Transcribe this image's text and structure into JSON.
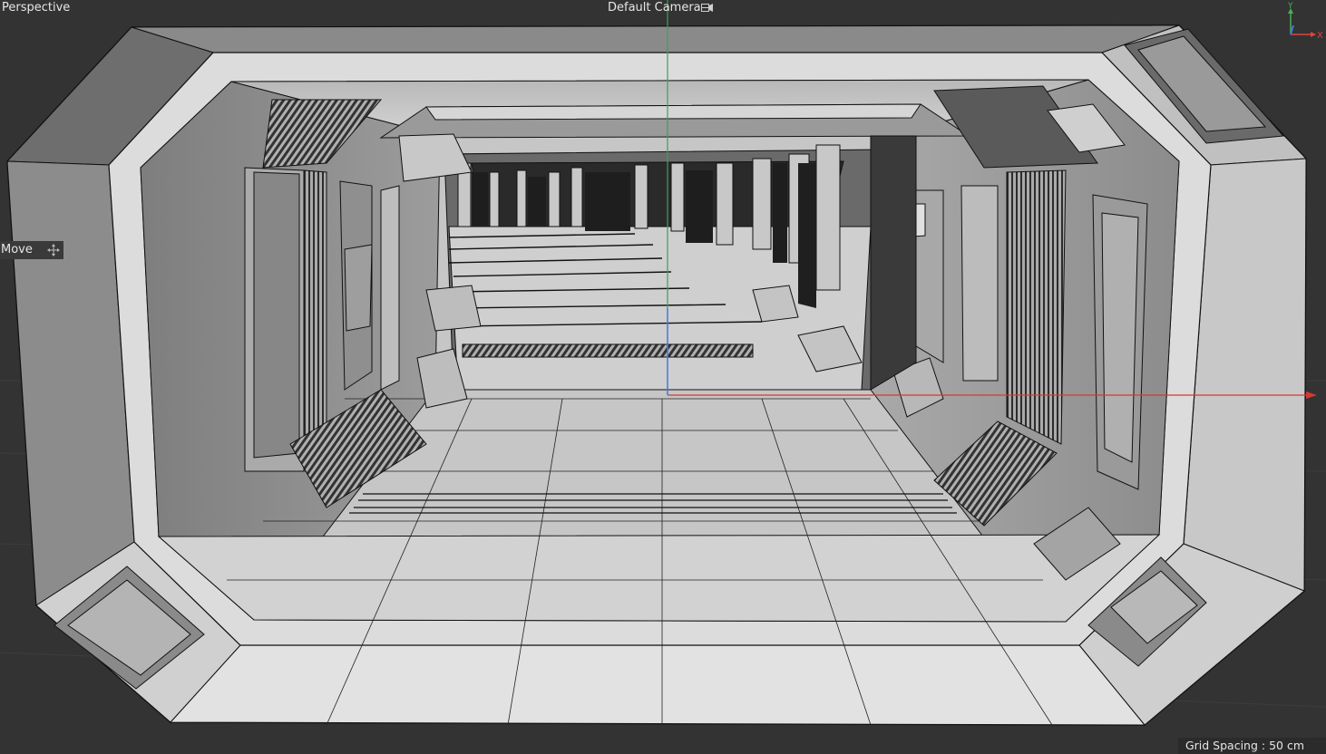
{
  "viewport": {
    "view_label": "Perspective",
    "camera_name": "Default Camera",
    "active_tool": "Move",
    "grid_spacing": "Grid Spacing : 50 cm"
  },
  "axis_gizmo": {
    "y_label": "Y",
    "x_label": "X",
    "y_color": "#4caf50",
    "x_color": "#e0443c",
    "z_color": "#3d7be0"
  },
  "icons": {
    "camera": "camera-icon",
    "move": "move-icon"
  },
  "colors": {
    "viewport_bg": "#333333",
    "hud_text": "#e6e6e6",
    "x_axis_line": "#d23a36",
    "y_axis_line": "#3aa05a",
    "geometry_light": "#d8d8d8",
    "geometry_mid": "#9a9a9a",
    "geometry_dark": "#4a4a4a"
  }
}
